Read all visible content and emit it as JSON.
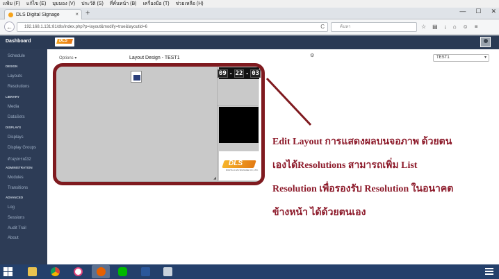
{
  "browser": {
    "menu": [
      "แฟ้ม (F)",
      "แก้ไข (E)",
      "มุมมอง (V)",
      "ประวัติ (S)",
      "ที่คั่นหน้า (B)",
      "เครื่องมือ (T)",
      "ช่วยเหลือ (H)"
    ],
    "tab_title": "DLS Digital Signage",
    "url": "192.168.1.131:81/dls/index.php?p=layout&modify=true&layoutid=6",
    "search_placeholder": "ค้นหา"
  },
  "app": {
    "brand": "Dashboard",
    "logo_text": "DLS",
    "sidebar": [
      {
        "type": "item",
        "label": "Schedule"
      },
      {
        "type": "head",
        "label": "DESIGN"
      },
      {
        "type": "item",
        "label": "Layouts"
      },
      {
        "type": "item",
        "label": "Resolutions"
      },
      {
        "type": "head",
        "label": "LIBRARY"
      },
      {
        "type": "item",
        "label": "Media"
      },
      {
        "type": "item",
        "label": "DataSets"
      },
      {
        "type": "head",
        "label": "DISPLAYS"
      },
      {
        "type": "item",
        "label": "Displays"
      },
      {
        "type": "item",
        "label": "Display Groups"
      },
      {
        "type": "item",
        "label": "ตัวอุปกรณ์32"
      },
      {
        "type": "head",
        "label": "ADMINISTRATION"
      },
      {
        "type": "item",
        "label": "Modules"
      },
      {
        "type": "item",
        "label": "Transitions"
      },
      {
        "type": "head",
        "label": "ADVANCED"
      },
      {
        "type": "item",
        "label": "Log"
      },
      {
        "type": "item",
        "label": "Sessions"
      },
      {
        "type": "item",
        "label": "Audit Trail"
      },
      {
        "type": "item",
        "label": "About"
      }
    ],
    "options_label": "Options",
    "layout_title": "Layout Design - TEST1",
    "layout_select": "TEST1",
    "clock": {
      "hh": "09",
      "mm": "22",
      "ss": "03"
    },
    "brand_logo_text": "DLS",
    "brand_logo_sub": "DIGITAL LIVE SIGNAGE CO.,LTD."
  },
  "annotation": {
    "lines": [
      "Edit Layout การแสดงผลบนจอภาพ ด้วยตน",
      "เองได้Resolutions  สามารถเพิ่ม List",
      "Resolution เพื่อรองรับ Resolution ในอนาคต",
      "ข้างหน้า ได้ด้วยตนเอง"
    ],
    "color": "#8d1b2b"
  },
  "taskbar": {
    "apps": [
      "file-explorer-icon",
      "chrome-icon",
      "app-icon",
      "firefox-icon",
      "line-icon",
      "word-icon",
      "tool-icon"
    ]
  }
}
